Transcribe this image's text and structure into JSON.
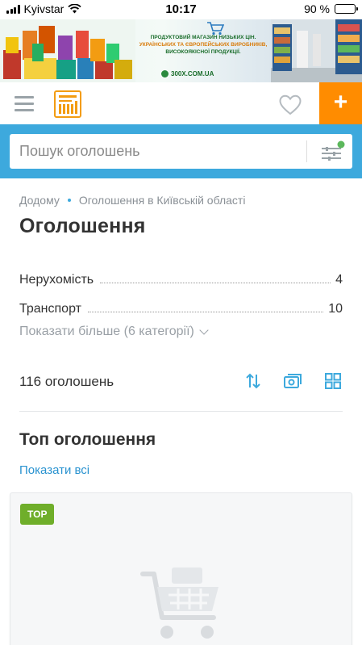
{
  "status_bar": {
    "carrier": "Kyivstar",
    "time": "10:17",
    "battery": "90 %",
    "battery_level": 0.9
  },
  "banner": {
    "line1": "ПРОДУКТОВИЙ МАГАЗИН НИЗЬКИХ ЦІН.",
    "line2": "УКРАЇНСЬКИХ ТА ЄВРОПЕЙСЬКИХ ВИРОБНИКІВ,",
    "line3": "ВИСОКОЯКІСНОЇ ПРОДУКЦІЇ.",
    "url": "300X.COM.UA"
  },
  "header": {
    "add_label": "+"
  },
  "search": {
    "placeholder": "Пошук оголошень"
  },
  "breadcrumb": {
    "home": "Додому",
    "current": "Оголошення в Київській області"
  },
  "page_title": "Оголошення",
  "categories": [
    {
      "name": "Нерухомість",
      "count": "4"
    },
    {
      "name": "Транспорт",
      "count": "10"
    }
  ],
  "show_more": "Показати більше (6 категорії)",
  "ads_count": "116 оголошень",
  "top_section": {
    "title": "Топ оголошення",
    "show_all": "Показати всі",
    "badge": "TOP"
  },
  "colors": {
    "accent_blue": "#3da9dd",
    "add_orange": "#ff8c00",
    "top_badge_green": "#6fae2a",
    "link_blue": "#2a93d0"
  },
  "icons": {
    "menu": "hamburger-menu-icon",
    "logo": "site-logo",
    "favorite": "heart-icon",
    "add": "plus-icon",
    "filter": "filter-sliders-icon",
    "sort": "sort-arrows-icon",
    "list_view": "photo-cards-icon",
    "grid_view": "grid-icon",
    "placeholder": "shopping-cart-icon"
  }
}
